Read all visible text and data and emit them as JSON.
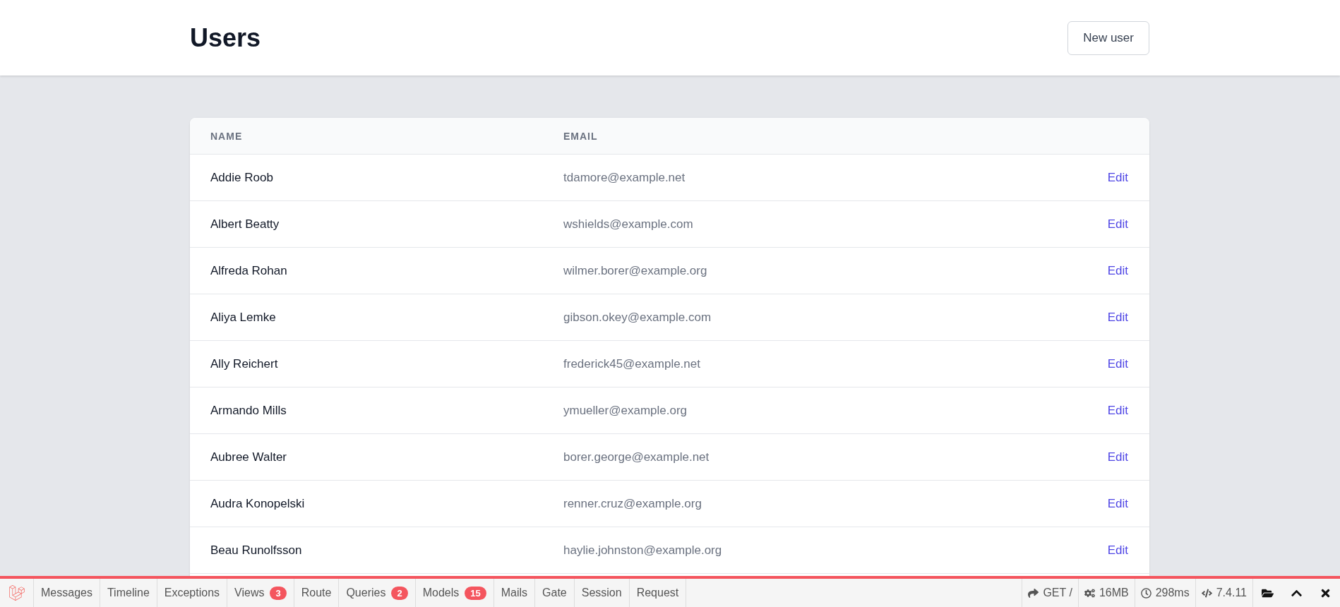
{
  "header": {
    "title": "Users",
    "button": "New user"
  },
  "table": {
    "columns": [
      "NAME",
      "EMAIL"
    ],
    "rows": [
      {
        "name": "Addie Roob",
        "email": "tdamore@example.net",
        "action": "Edit"
      },
      {
        "name": "Albert Beatty",
        "email": "wshields@example.com",
        "action": "Edit"
      },
      {
        "name": "Alfreda Rohan",
        "email": "wilmer.borer@example.org",
        "action": "Edit"
      },
      {
        "name": "Aliya Lemke",
        "email": "gibson.okey@example.com",
        "action": "Edit"
      },
      {
        "name": "Ally Reichert",
        "email": "frederick45@example.net",
        "action": "Edit"
      },
      {
        "name": "Armando Mills",
        "email": "ymueller@example.org",
        "action": "Edit"
      },
      {
        "name": "Aubree Walter",
        "email": "borer.george@example.net",
        "action": "Edit"
      },
      {
        "name": "Audra Konopelski",
        "email": "renner.cruz@example.org",
        "action": "Edit"
      },
      {
        "name": "Beau Runolfsson",
        "email": "haylie.johnston@example.org",
        "action": "Edit"
      }
    ]
  },
  "debugbar": {
    "tabs": [
      {
        "label": "Messages"
      },
      {
        "label": "Timeline"
      },
      {
        "label": "Exceptions"
      },
      {
        "label": "Views",
        "badge": "3"
      },
      {
        "label": "Route"
      },
      {
        "label": "Queries",
        "badge": "2"
      },
      {
        "label": "Models",
        "badge": "15"
      },
      {
        "label": "Mails"
      },
      {
        "label": "Gate"
      },
      {
        "label": "Session"
      },
      {
        "label": "Request"
      }
    ],
    "indicators": [
      {
        "kind": "request",
        "text": "GET /"
      },
      {
        "kind": "memory",
        "text": "16MB"
      },
      {
        "kind": "time",
        "text": "298ms"
      },
      {
        "kind": "version",
        "text": "7.4.11"
      }
    ]
  }
}
